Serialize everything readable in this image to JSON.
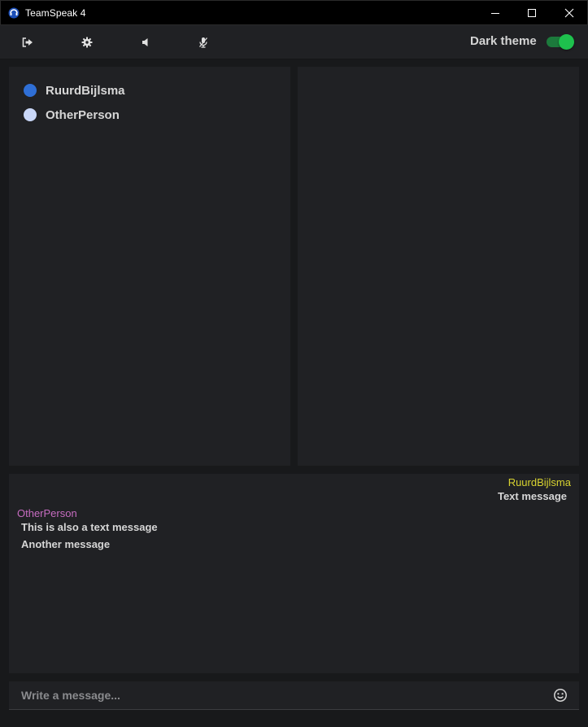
{
  "window": {
    "title": "TeamSpeak 4",
    "controls": [
      "minimize-icon",
      "maximize-icon",
      "close-icon"
    ]
  },
  "toolbar": {
    "buttons": [
      "leave-icon",
      "settings-gear-icon",
      "speaker-icon",
      "mic-muted-icon"
    ],
    "theme_label": "Dark theme",
    "theme_toggle_on": true,
    "toggle_color": "#1ec14d"
  },
  "users": [
    {
      "name": "RuurdBijlsma",
      "status_color": "#2f6fd6"
    },
    {
      "name": "OtherPerson",
      "status_color": "#c9d7f8"
    }
  ],
  "chat": {
    "messages": [
      {
        "sender": "RuurdBijlsma",
        "sender_color": "#d8d330",
        "side": "right",
        "lines": [
          "Text message"
        ]
      },
      {
        "sender": "OtherPerson",
        "sender_color": "#c66cc0",
        "side": "left",
        "lines": [
          "This is also a text message",
          "Another message"
        ]
      }
    ]
  },
  "composer": {
    "placeholder": "Write a message...",
    "value": "",
    "emoji_icon": "smiley-icon"
  }
}
